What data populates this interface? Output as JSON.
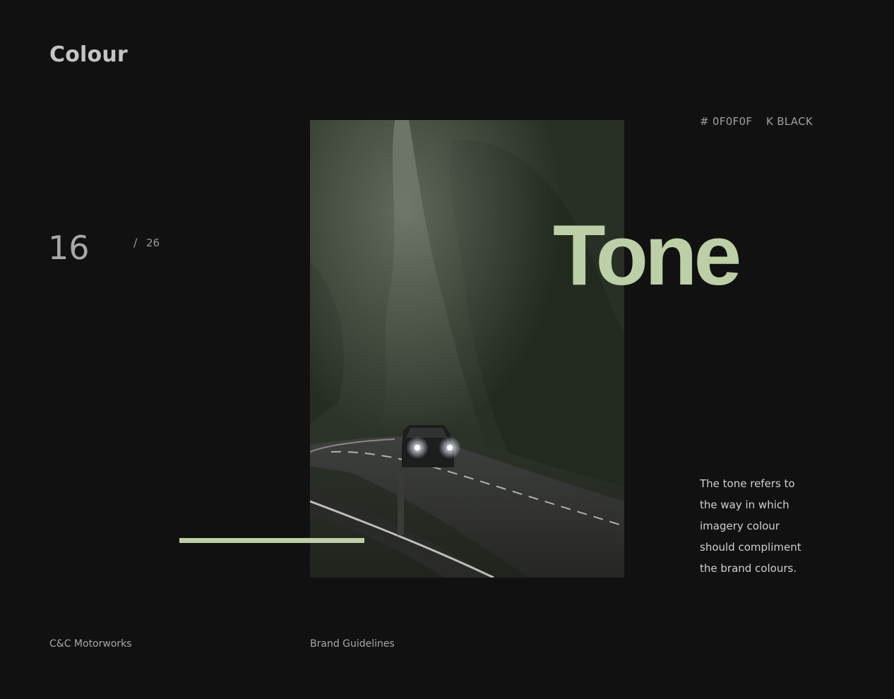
{
  "header": {
    "title": "Colour"
  },
  "pagination": {
    "current": "16",
    "separator": "/",
    "total": "26"
  },
  "swatch": {
    "hex": "# 0F0F0F",
    "name": "K BLACK"
  },
  "hero": {
    "heading": "Tone",
    "image": "forest-road-car-photo"
  },
  "description": {
    "lines": [
      "The tone refers to",
      "the way in which",
      "imagery colour",
      "should compliment",
      "the brand colours."
    ]
  },
  "footer": {
    "company": "C&C Motorworks",
    "document": "Brand Guidelines"
  },
  "colors": {
    "background": "#111111",
    "accent": "#BCCFA6",
    "text": "#B8B8B8"
  }
}
